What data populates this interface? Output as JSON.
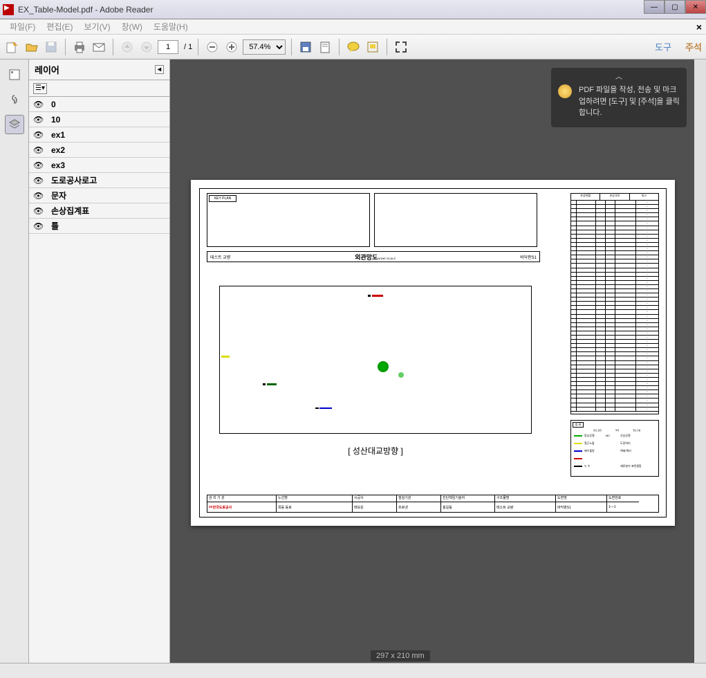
{
  "window": {
    "title": "EX_Table-Model.pdf - Adobe Reader"
  },
  "menu": {
    "file": "파일(F)",
    "edit": "편집(E)",
    "view": "보기(V)",
    "window": "창(W)",
    "help": "도움말(H)"
  },
  "toolbar": {
    "page_current": "1",
    "page_total": "/ 1",
    "zoom": "57.4%",
    "tools_link": "도구",
    "annotate_link": "주석"
  },
  "tooltip": {
    "text": "PDF 파일을 작성, 전송 및 마크업하려면 [도구] 및 [주석]을 클릭합니다."
  },
  "layers": {
    "panel_title": "레이어",
    "items": [
      "0",
      "10",
      "ex1",
      "ex2",
      "ex3",
      "도로공사로고",
      "문자",
      "손상집계표",
      "틀"
    ]
  },
  "doc": {
    "size_label": "297 x 210 mm",
    "keyplan_label": "KEY PLAN",
    "title_left": "테스트 교량",
    "title_center": "외관망도",
    "title_center_sub": "NONE SCALE",
    "title_right": "바닥판S1",
    "plan_caption": "[ 성산대교방향 ]",
    "side_table": {
      "title_left": "손상현황",
      "title_right": "손상규모",
      "title_note": "비고",
      "rows_count": 50
    },
    "legend": {
      "title": "범 례",
      "headers": [
        "망도 표현",
        "약어",
        "망도구분"
      ],
      "items": [
        {
          "label": "망상균열",
          "abbr": "MC",
          "cat": "선상균열",
          "color": "#0a0"
        },
        {
          "label": "철근노출",
          "abbr": "",
          "cat": "도장박리",
          "color": "#dd0"
        },
        {
          "label": "배수불량",
          "abbr": "",
          "cat": "백태/백리",
          "color": "#00c"
        },
        {
          "label": "",
          "abbr": "",
          "cat": "",
          "color": "#c00"
        },
        {
          "label": "누 수",
          "abbr": "",
          "cat": "재료분리  표면결함",
          "color": "#000"
        }
      ]
    },
    "bottom": {
      "cells": [
        {
          "h": "관 리 기 관",
          "v": "한국도로공사",
          "w": 100,
          "logo": true
        },
        {
          "h": "노선명",
          "v": "목동 동로",
          "w": 110
        },
        {
          "h": "시공사",
          "v": "태보운",
          "w": 64
        },
        {
          "h": "점검기관",
          "v": "프로넷",
          "w": 64
        },
        {
          "h": "진단책임기술자",
          "v": "홍길동",
          "w": 78
        },
        {
          "h": "구조물명",
          "v": "테스트 교량",
          "w": 88
        },
        {
          "h": "도면명",
          "v": "바닥판S1",
          "w": 74
        },
        {
          "h": "도면번호",
          "v": "1—1",
          "w": 46
        }
      ]
    }
  }
}
